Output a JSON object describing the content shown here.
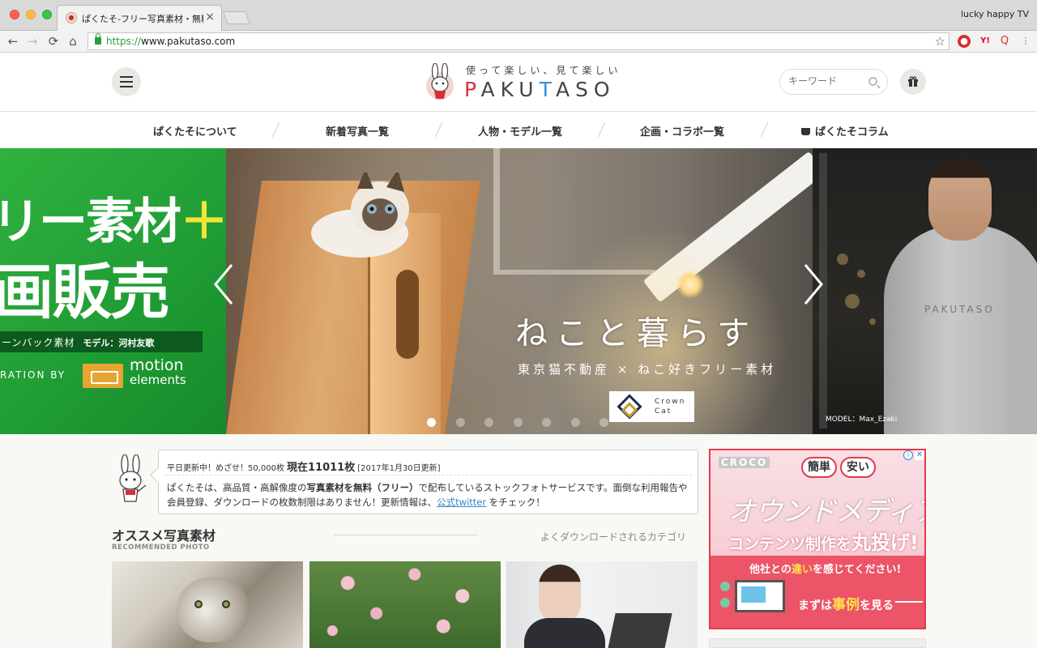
{
  "browser": {
    "tab_title": "ぱくたそ-フリー写真素材・無料ダ",
    "tab_close": "×",
    "profile": "lucky happy TV",
    "url_scheme": "https://",
    "url_rest": "www.pakutaso.com",
    "star": "☆",
    "nav": {
      "back": "←",
      "forward": "→",
      "reload": "⟳",
      "home": "⌂"
    },
    "ext_yahoo": "Y!",
    "ext_search": "Q",
    "menu": "⋮"
  },
  "header": {
    "tagline": "使って楽しい、見て楽しい",
    "logo_text": "PAKUTASO",
    "logo_p": "P",
    "logo_aku": "AKU",
    "logo_t": "T",
    "logo_aso": "ASO",
    "search_placeholder": "キーワード"
  },
  "nav": {
    "items": [
      {
        "label": "ぱくたそについて"
      },
      {
        "label": "新着写真一覧"
      },
      {
        "label": "人物・モデル一覧"
      },
      {
        "label": "企画・コラボ一覧"
      },
      {
        "label": "ぱくたそコラム"
      }
    ]
  },
  "hero": {
    "left": {
      "line1": "リー素材",
      "plus": "＋",
      "line2": "画販売",
      "bar_text": "ーンバック素材",
      "bar_model": "モデル：河村友歌",
      "collab": "RATION BY",
      "me_line1": "motion",
      "me_line2": "elements"
    },
    "main": {
      "title": "ねこと暮らす",
      "subtitle": "東京猫不動産 × ねこ好きフリー素材",
      "badge_text": "Crown\nCat"
    },
    "right": {
      "hoodie": "PAKUTASO",
      "model_credit": "MODEL：Max_Ezaki"
    },
    "dots": [
      true,
      false,
      false,
      false,
      false,
      false,
      false
    ]
  },
  "info": {
    "top_prefix": "平日更新中！めざせ！50,000枚",
    "top_count": "現在11011枚",
    "top_date": "[2017年1月30日更新]",
    "body_1": "ぱくたそは、高品質・高解像度の",
    "body_bold": "写真素材を無料（フリー）",
    "body_2": "で配布しているストックフォトサービスです。面倒な利用報告や会員登録、ダウンロードの枚数制限はありません！更新情報は、",
    "body_link": "公式twitter",
    "body_3": "をチェック！"
  },
  "recommended": {
    "title": "オススメ写真素材",
    "subtitle": "RECOMMENDED PHOTO",
    "link": "よくダウンロードされるカテゴリ"
  },
  "ad": {
    "logo": "CROCO",
    "info": "i",
    "close": "✕",
    "bubble1": "簡単",
    "bubble2": "安い",
    "main": "オウンドメディア",
    "suffix": "の",
    "line2a": "コンテンツ制作を",
    "line2b": "丸投げ!",
    "line3a": "他社との",
    "line3b": "違い",
    "line3c": "を感じてください!",
    "cta_a": "まずは",
    "cta_b": "事例",
    "cta_c": "を見る"
  },
  "colors": {
    "pakutaso_red": "#d3313b",
    "pakutaso_blue": "#3b8fd3",
    "green_banner": "#2fb23f",
    "link_blue": "#2f86c4",
    "ad_red": "#e23a4d"
  }
}
